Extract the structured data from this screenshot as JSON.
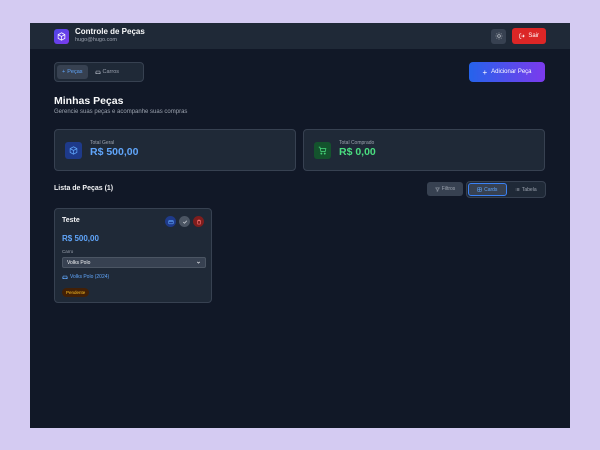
{
  "header": {
    "title": "Controle de Peças",
    "email": "hugo@hugo.com",
    "logout_label": "Sair"
  },
  "nav": {
    "tabs": [
      {
        "label": "Peças",
        "active": true
      },
      {
        "label": "Carros",
        "active": false
      }
    ]
  },
  "add_button_label": "Adicionar Peça",
  "page": {
    "title": "Minhas Peças",
    "subtitle": "Gerencie suas peças e acompanhe suas compras"
  },
  "stats": [
    {
      "label": "Total Geral",
      "value": "R$ 500,00",
      "color": "#60a5fa"
    },
    {
      "label": "Total Comprado",
      "value": "R$ 0,00",
      "color": "#4ade80"
    }
  ],
  "list": {
    "title": "Lista de Peças (1)",
    "filter_label": "Filtros",
    "view_options": [
      {
        "label": "Cards",
        "active": true
      },
      {
        "label": "Tabela",
        "active": false
      }
    ]
  },
  "cards": [
    {
      "title": "Teste",
      "price": "R$ 500,00",
      "car_label": "Carro",
      "car_selected": "Volks Polo",
      "car_link": "Volks Polo (2024)",
      "status": "Pendente"
    }
  ],
  "colors": {
    "background": "#111827",
    "surface": "#1f2937",
    "accent": "#60a5fa",
    "danger": "#dc2626",
    "success": "#4ade80"
  }
}
